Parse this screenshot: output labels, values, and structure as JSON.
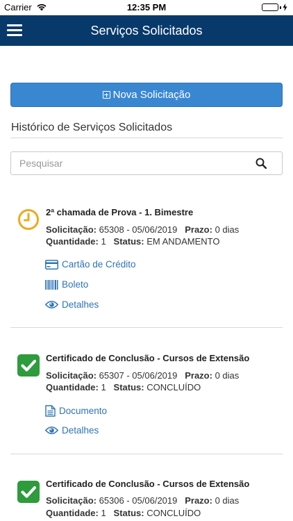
{
  "status_bar": {
    "carrier": "Carrier",
    "time": "12:35 PM"
  },
  "header": {
    "title": "Serviços Solicitados"
  },
  "new_request_button": {
    "label": "Nova Solicitação"
  },
  "history": {
    "title": "Histórico de Serviços Solicitados"
  },
  "search": {
    "placeholder": "Pesquisar",
    "value": ""
  },
  "labels": {
    "request": "Solicitação:",
    "deadline": "Prazo:",
    "quantity": "Quantidade:",
    "status": "Status:"
  },
  "colors": {
    "header": "#08396b",
    "accent": "#3a87d1",
    "link": "#2f74b5",
    "in_progress": "#f0a81c",
    "done": "#2e9b3c"
  },
  "items": [
    {
      "title": "2ª chamada de Prova - 1. Bimestre",
      "request": "65308 - 05/06/2019",
      "deadline": "0 dias",
      "quantity": "1",
      "status": "EM ANDAMENTO",
      "icon": "clock-icon",
      "actions": [
        {
          "label": "Cartão de Crédito",
          "icon": "credit-card-icon"
        },
        {
          "label": "Boleto",
          "icon": "barcode-icon"
        },
        {
          "label": "Detalhes",
          "icon": "eye-icon"
        }
      ]
    },
    {
      "title": "Certificado de Conclusão - Cursos de Extensão",
      "request": "65307 - 05/06/2019",
      "deadline": "0 dias",
      "quantity": "1",
      "status": "CONCLUÍDO",
      "icon": "checkmark-icon",
      "actions": [
        {
          "label": "Documento",
          "icon": "document-icon"
        },
        {
          "label": "Detalhes",
          "icon": "eye-icon"
        }
      ]
    },
    {
      "title": "Certificado de Conclusão - Cursos de Extensão",
      "request": "65306 - 05/06/2019",
      "deadline": "0 dias",
      "quantity": "1",
      "status": "CONCLUÍDO",
      "icon": "checkmark-icon",
      "actions": []
    }
  ]
}
